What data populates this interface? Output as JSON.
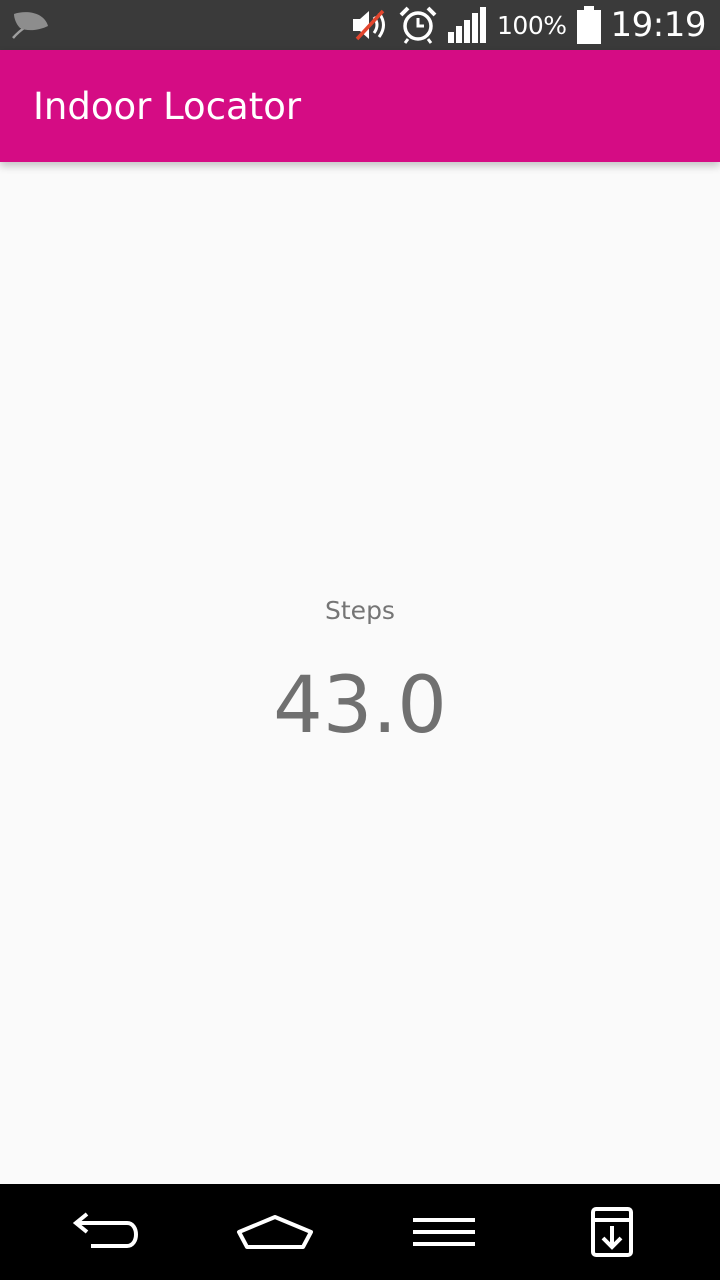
{
  "status_bar": {
    "battery_percent": "100%",
    "time": "19:19",
    "icons": [
      "leaf-icon",
      "muted-speaker-icon",
      "alarm-clock-icon",
      "signal-bars-icon",
      "battery-icon"
    ]
  },
  "app_bar": {
    "title": "Indoor Locator",
    "color": "#d50c84"
  },
  "main": {
    "steps_label": "Steps",
    "steps_value": "43.0"
  },
  "nav_bar": {
    "buttons": [
      "back-icon",
      "home-icon",
      "menu-icon",
      "download-icon"
    ]
  }
}
